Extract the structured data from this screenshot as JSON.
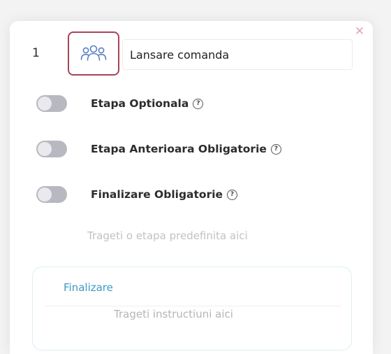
{
  "step": {
    "number": "1",
    "icon": "users-group-icon",
    "name_value": "Lansare comanda",
    "close_icon": "close-icon"
  },
  "toggles": [
    {
      "label": "Etapa Optionala",
      "enabled": false
    },
    {
      "label": "Etapa Anterioara Obligatorie",
      "enabled": false
    },
    {
      "label": "Finalizare Obligatorie",
      "enabled": false
    }
  ],
  "steps_drop_hint": "Trageti o etapa predefinita aici",
  "finalization": {
    "title": "Finalizare",
    "drop_hint": "Trageti instructiuni aici"
  },
  "colors": {
    "highlight_border": "#a84458",
    "accent_blue": "#3c9ac6",
    "icon_blue": "#5b7fc4",
    "close": "#e2a8b3"
  }
}
